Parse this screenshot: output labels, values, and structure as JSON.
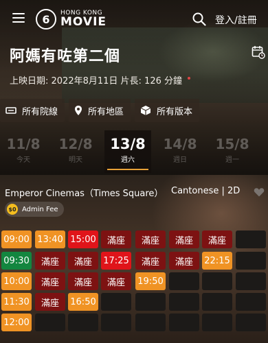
{
  "app": {
    "logo_small": "HONG KONG",
    "logo_big": "MOVIE",
    "logo_mark": "6",
    "login": "登入/註冊"
  },
  "movie": {
    "title": "阿媽有咗第二個",
    "meta": "上映日期: 2022年8月11日 片長: 126 分鐘"
  },
  "filters": [
    {
      "label": "所有院線",
      "icon": "cinema-icon"
    },
    {
      "label": "所有地區",
      "icon": "location-pin-icon"
    },
    {
      "label": "所有版本",
      "icon": "box-icon"
    }
  ],
  "dates": [
    {
      "day": "11/8",
      "weekday": "今天",
      "active": false
    },
    {
      "day": "12/8",
      "weekday": "明天",
      "active": false
    },
    {
      "day": "13/8",
      "weekday": "週六",
      "active": true
    },
    {
      "day": "14/8",
      "weekday": "週日",
      "active": false
    },
    {
      "day": "15/8",
      "weekday": "週一",
      "active": false
    }
  ],
  "cinema": {
    "name": "Emperor Cinemas（Times Square）",
    "format": "Cantonese | 2D",
    "fee_coin": "$0",
    "fee_label": "Admin Fee"
  },
  "showtimes": [
    [
      {
        "t": "09:00",
        "s": "orange"
      },
      {
        "t": "13:40",
        "s": "orange"
      },
      {
        "t": "15:00",
        "s": "red"
      },
      {
        "t": "滿座",
        "s": "full"
      },
      {
        "t": "滿座",
        "s": "full"
      },
      {
        "t": "滿座",
        "s": "full"
      },
      {
        "t": "滿座",
        "s": "full"
      },
      {
        "t": "",
        "s": "empty"
      }
    ],
    [
      {
        "t": "09:30",
        "s": "green"
      },
      {
        "t": "滿座",
        "s": "full"
      },
      {
        "t": "滿座",
        "s": "full"
      },
      {
        "t": "17:25",
        "s": "red"
      },
      {
        "t": "滿座",
        "s": "full"
      },
      {
        "t": "滿座",
        "s": "full"
      },
      {
        "t": "22:15",
        "s": "orange"
      },
      {
        "t": "",
        "s": "empty"
      }
    ],
    [
      {
        "t": "10:00",
        "s": "orange"
      },
      {
        "t": "滿座",
        "s": "full"
      },
      {
        "t": "滿座",
        "s": "full"
      },
      {
        "t": "滿座",
        "s": "full"
      },
      {
        "t": "19:50",
        "s": "orange"
      },
      {
        "t": "",
        "s": "empty"
      },
      {
        "t": "",
        "s": "empty"
      },
      {
        "t": "",
        "s": "empty"
      }
    ],
    [
      {
        "t": "11:30",
        "s": "orange"
      },
      {
        "t": "滿座",
        "s": "full"
      },
      {
        "t": "16:50",
        "s": "orange"
      },
      {
        "t": "",
        "s": "empty"
      },
      {
        "t": "",
        "s": "empty"
      },
      {
        "t": "",
        "s": "empty"
      },
      {
        "t": "",
        "s": "empty"
      },
      {
        "t": "",
        "s": "empty"
      }
    ],
    [
      {
        "t": "12:00",
        "s": "orange"
      },
      {
        "t": "",
        "s": "empty"
      },
      {
        "t": "",
        "s": "empty"
      },
      {
        "t": "",
        "s": "empty"
      },
      {
        "t": "",
        "s": "empty"
      },
      {
        "t": "",
        "s": "empty"
      },
      {
        "t": "",
        "s": "empty"
      },
      {
        "t": "",
        "s": "empty"
      }
    ]
  ],
  "colors": {
    "orange": "#f09324",
    "red": "#e0141a",
    "full": "#7d1212",
    "green": "#13863f",
    "accent": "#e8a238"
  }
}
